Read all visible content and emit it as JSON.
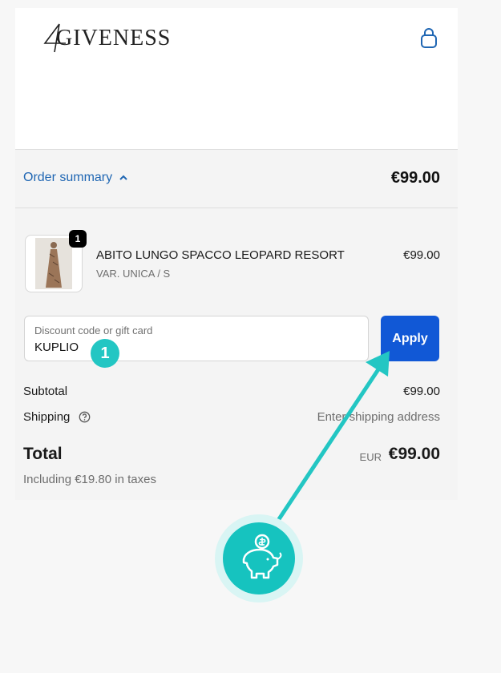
{
  "brand": {
    "name": "GIVENESS",
    "prefix": "4"
  },
  "summary": {
    "toggle_label": "Order summary",
    "total": "€99.00"
  },
  "item": {
    "quantity": "1",
    "name": "ABITO LUNGO SPACCO LEOPARD RESORT",
    "variant": "VAR. UNICA / S",
    "price": "€99.00"
  },
  "discount": {
    "label": "Discount code or gift card",
    "value": "KUPLIO",
    "apply_label": "Apply"
  },
  "totals": {
    "subtotal_label": "Subtotal",
    "subtotal_value": "€99.00",
    "shipping_label": "Shipping",
    "shipping_value": "Enter shipping address",
    "total_label": "Total",
    "currency": "EUR",
    "total_value": "€99.00",
    "taxes_note": "Including €19.80 in taxes"
  },
  "overlay": {
    "step_number": "1"
  },
  "colors": {
    "accent": "#1158d6",
    "link": "#1f66b3",
    "teal": "#16c3bf"
  }
}
